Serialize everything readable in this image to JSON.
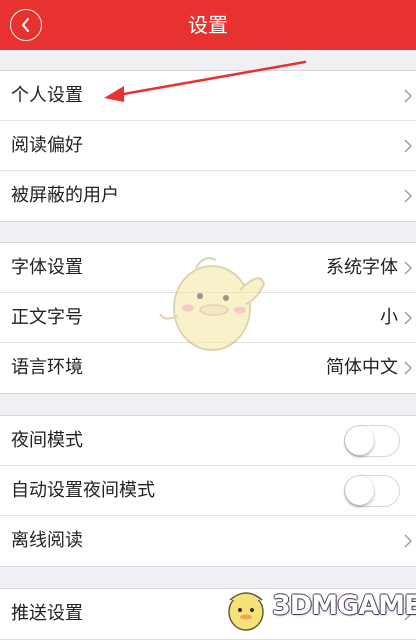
{
  "header": {
    "title": "设置",
    "back_icon": "chevron-left-icon"
  },
  "colors": {
    "header_bg": "#e8322f",
    "page_bg": "#efeff4"
  },
  "sections": [
    {
      "rows": [
        {
          "label": "个人设置"
        },
        {
          "label": "阅读偏好"
        },
        {
          "label": "被屏蔽的用户"
        }
      ]
    },
    {
      "rows": [
        {
          "label": "字体设置",
          "value": "系统字体"
        },
        {
          "label": "正文字号",
          "value": "小"
        },
        {
          "label": "语言环境",
          "value": "简体中文"
        }
      ]
    },
    {
      "rows": [
        {
          "label": "夜间模式",
          "toggle": "off"
        },
        {
          "label": "自动设置夜间模式",
          "toggle": "off"
        },
        {
          "label": "离线阅读"
        }
      ]
    },
    {
      "rows": [
        {
          "label": "推送设置"
        }
      ]
    }
  ],
  "watermark": {
    "text": "3DMGAME"
  }
}
